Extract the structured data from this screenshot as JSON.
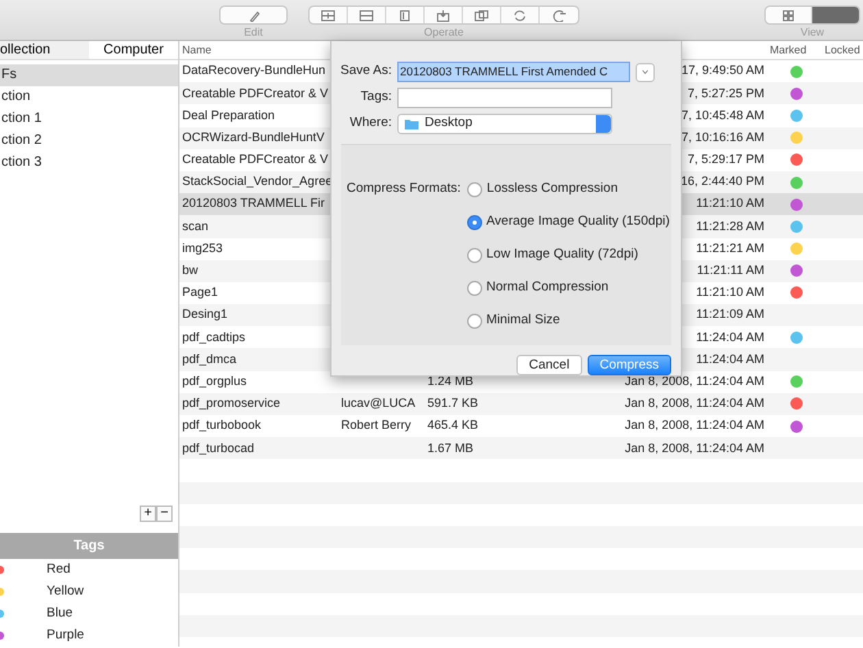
{
  "toolbar": {
    "edit": {
      "label": "Edit"
    },
    "operate": {
      "label": "Operate"
    },
    "view": {
      "label": "View",
      "segments": [
        {
          "selected": false
        },
        {
          "selected": true
        }
      ]
    }
  },
  "sidebar": {
    "tabs": [
      {
        "label": "ollection",
        "selected": false
      },
      {
        "label": "Computer",
        "selected": true
      }
    ],
    "items": [
      {
        "label": "Fs",
        "selected": true
      },
      {
        "label": "ction",
        "selected": false
      },
      {
        "label": "ction 1",
        "selected": false
      },
      {
        "label": "ction 2",
        "selected": false
      },
      {
        "label": "ction 3",
        "selected": false
      }
    ],
    "add": "+",
    "remove": "−",
    "tags_header": "Tags",
    "tags": [
      {
        "label": "Red",
        "color": "#fb5a55"
      },
      {
        "label": "Yellow",
        "color": "#fdd24f"
      },
      {
        "label": "Blue",
        "color": "#5bc3ee"
      },
      {
        "label": "Purple",
        "color": "#c257d6"
      }
    ]
  },
  "table": {
    "header": {
      "name": "Name",
      "marked": "Marked",
      "locked": "Locked"
    },
    "rows": [
      {
        "name": "DataRecovery-BundleHun",
        "date": "17, 9:49:50 AM",
        "color": "#5ad05f",
        "selected": false
      },
      {
        "name": "Creatable PDFCreator & V",
        "date": "7, 5:27:25 PM",
        "color": "#c257d6",
        "selected": false
      },
      {
        "name": "Deal Preparation",
        "date": "7, 10:45:48 AM",
        "color": "#5bc3ee",
        "selected": false
      },
      {
        "name": "OCRWizard-BundleHuntV",
        "date": "7, 10:16:16 AM",
        "color": "#fdd24f",
        "selected": false
      },
      {
        "name": "Creatable PDFCreator & V",
        "date": "7, 5:29:17 PM",
        "color": "#fb5a55",
        "selected": false
      },
      {
        "name": "StackSocial_Vendor_Agree",
        "date": "16, 2:44:40 PM",
        "color": "#5ad05f",
        "selected": false
      },
      {
        "name": "20120803 TRAMMELL Fir",
        "date": "11:21:10 AM",
        "color": "#c257d6",
        "selected": true
      },
      {
        "name": "scan",
        "date": "11:21:28 AM",
        "color": "#5bc3ee",
        "selected": false
      },
      {
        "name": "img253",
        "date": "11:21:21 AM",
        "color": "#fdd24f",
        "selected": false
      },
      {
        "name": "bw",
        "date": "11:21:11 AM",
        "color": "#c257d6",
        "selected": false
      },
      {
        "name": "Page1",
        "date": "11:21:10 AM",
        "color": "#fb5a55",
        "selected": false
      },
      {
        "name": "Desing1",
        "date": "11:21:09 AM",
        "selected": false
      },
      {
        "name": "pdf_cadtips",
        "date": "11:24:04 AM",
        "color": "#5bc3ee",
        "selected": false
      },
      {
        "name": "pdf_dmca",
        "date": "11:24:04 AM",
        "selected": false
      },
      {
        "name": "pdf_orgplus",
        "size": "1.24 MB",
        "date": "Jan 8, 2008, 11:24:04 AM",
        "color": "#5ad05f",
        "selected": false
      },
      {
        "name": "pdf_promoservice",
        "author": "lucav@LUCA",
        "size": "591.7 KB",
        "date": "Jan 8, 2008, 11:24:04 AM",
        "color": "#fb5a55",
        "selected": false
      },
      {
        "name": "pdf_turbobook",
        "author": "Robert Berry",
        "size": "465.4 KB",
        "date": "Jan 8, 2008, 11:24:04 AM",
        "color": "#c257d6",
        "selected": false
      },
      {
        "name": "pdf_turbocad",
        "size": "1.67 MB",
        "date": "Jan 8, 2008, 11:24:04 AM",
        "selected": false
      }
    ]
  },
  "dialog": {
    "save_as": {
      "label": "Save As:",
      "value": "20120803 TRAMMELL First Amended C"
    },
    "tags": {
      "label": "Tags:"
    },
    "where": {
      "label": "Where:",
      "value": "Desktop"
    },
    "compress_formats": {
      "label": "Compress Formats:",
      "options": [
        {
          "label": "Lossless Compression",
          "selected": false
        },
        {
          "label": "Average Image Quality (150dpi)",
          "selected": true
        },
        {
          "label": "Low Image Quality (72dpi)",
          "selected": false
        },
        {
          "label": "Normal Compression",
          "selected": false
        },
        {
          "label": "Minimal Size",
          "selected": false
        }
      ]
    },
    "buttons": [
      {
        "label": "Cancel",
        "kind": "secondary"
      },
      {
        "label": "Compress",
        "kind": "primary"
      }
    ]
  }
}
